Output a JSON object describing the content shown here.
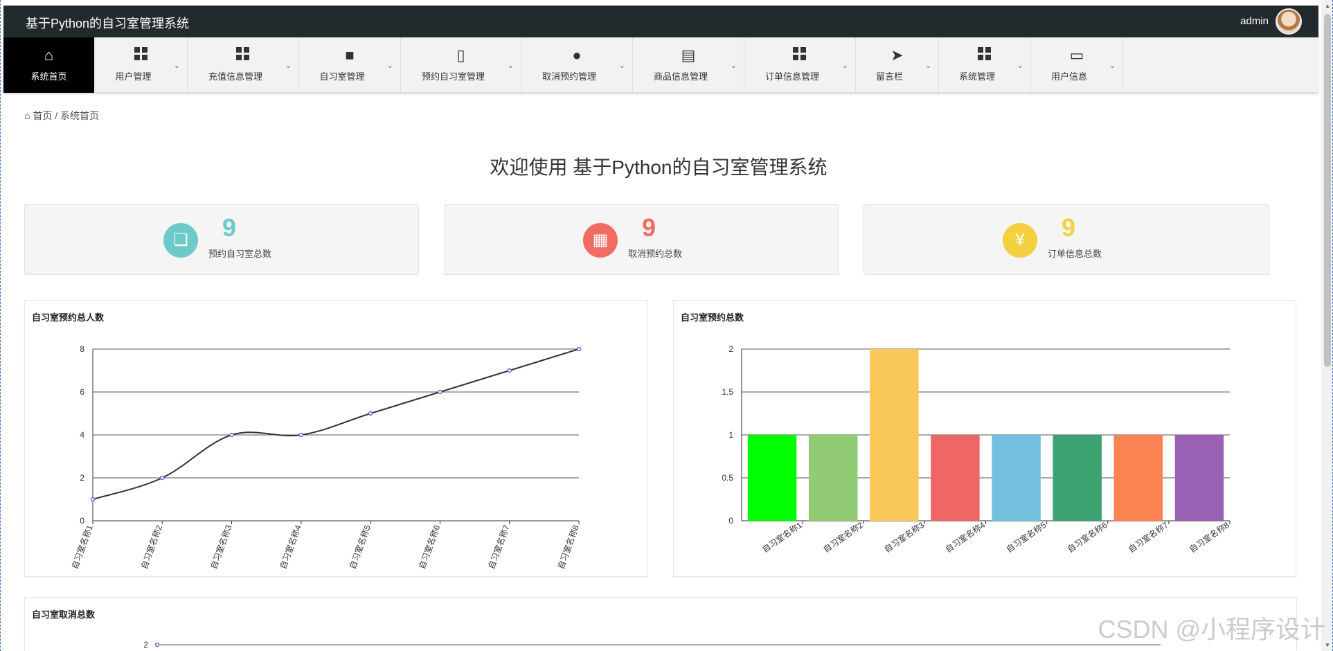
{
  "app": {
    "title": "基于Python的自习室管理系统",
    "user": "admin"
  },
  "nav": [
    {
      "label": "系统首页",
      "icon": "home-icon",
      "active": true,
      "caret": false
    },
    {
      "label": "用户管理",
      "icon": "grid-icon",
      "caret": true
    },
    {
      "label": "充值信息管理",
      "icon": "grid-icon",
      "caret": true
    },
    {
      "label": "自习室管理",
      "icon": "monitor-icon",
      "caret": true
    },
    {
      "label": "预约自习室管理",
      "icon": "bar-chart-icon",
      "caret": true
    },
    {
      "label": "取消预约管理",
      "icon": "user-icon",
      "caret": true
    },
    {
      "label": "商品信息管理",
      "icon": "clipboard-icon",
      "caret": true
    },
    {
      "label": "订单信息管理",
      "icon": "grid-icon",
      "caret": true
    },
    {
      "label": "留言栏",
      "icon": "paper-plane-icon",
      "caret": true
    },
    {
      "label": "系统管理",
      "icon": "grid-icon",
      "caret": true
    },
    {
      "label": "用户信息",
      "icon": "card-icon",
      "caret": true
    }
  ],
  "breadcrumb": {
    "home": "首页",
    "separator": "/",
    "current": "系统首页"
  },
  "welcome": "欢迎使用 基于Python的自习室管理系统",
  "stats": [
    {
      "value": "9",
      "label": "预约自习室总数",
      "color": "#6ec9c9",
      "icon": "cubes-icon"
    },
    {
      "value": "9",
      "label": "取消预约总数",
      "color": "#f36c63",
      "icon": "apps-icon"
    },
    {
      "value": "9",
      "label": "订单信息总数",
      "color": "#f5d142",
      "icon": "yen-card-icon"
    }
  ],
  "chart_data": [
    {
      "type": "line",
      "title": "自习室预约总人数",
      "categories": [
        "自习室名称1",
        "自习室名称2",
        "自习室名称3",
        "自习室名称4",
        "自习室名称5",
        "自习室名称6",
        "自习室名称7",
        "自习室名称8"
      ],
      "values": [
        1,
        2,
        4,
        4,
        5,
        6,
        7,
        8
      ],
      "ylim": [
        0,
        8
      ],
      "yticks": [
        0,
        2,
        4,
        6,
        8
      ],
      "grid": true
    },
    {
      "type": "bar",
      "title": "自习室预约总数",
      "categories": [
        "自习室名称1",
        "自习室名称2",
        "自习室名称3",
        "自习室名称4",
        "自习室名称5",
        "自习室名称6",
        "自习室名称7",
        "自习室名称8"
      ],
      "values": [
        1,
        1,
        2,
        1,
        1,
        1,
        1,
        1
      ],
      "colors": [
        "#00ff00",
        "#91cc75",
        "#fac858",
        "#ee6666",
        "#73c0de",
        "#3ba272",
        "#fc8452",
        "#9a60b4"
      ],
      "ylim": [
        0,
        2
      ],
      "yticks": [
        0,
        0.5,
        1,
        1.5,
        2
      ],
      "grid": true
    },
    {
      "type": "line",
      "title": "自习室取消总数",
      "yticks": [
        2
      ]
    }
  ],
  "watermark": "CSDN @小程序设计"
}
